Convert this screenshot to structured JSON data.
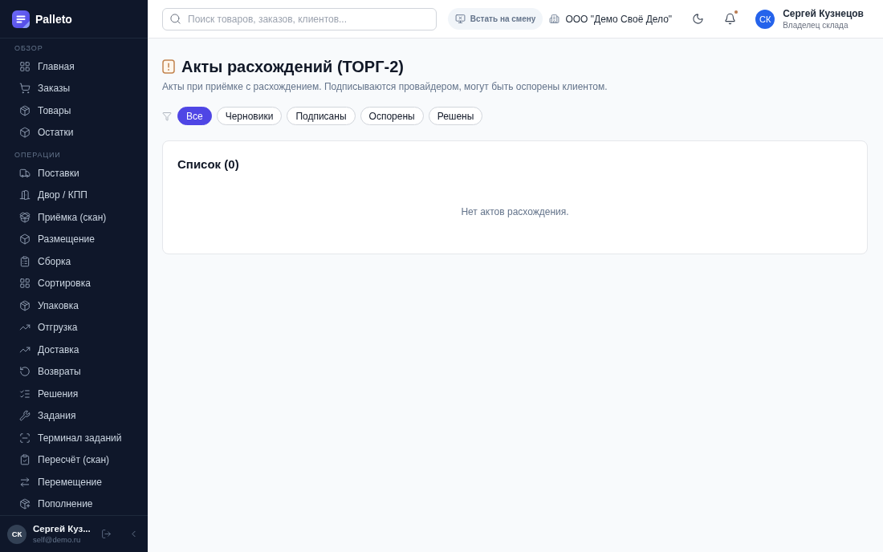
{
  "sidebar": {
    "logo": {
      "name": "Palleto"
    },
    "sections": [
      {
        "title": "ОБЗОР",
        "items": [
          {
            "label": "Главная",
            "selected": false
          },
          {
            "label": "Заказы",
            "selected": false
          },
          {
            "label": "Товары",
            "selected": false
          },
          {
            "label": "Остатки",
            "selected": false
          }
        ]
      },
      {
        "title": "ОПЕРАЦИИ",
        "items": [
          {
            "label": "Поставки",
            "selected": false
          },
          {
            "label": "Двор / КПП",
            "selected": false
          },
          {
            "label": "Приёмка (скан)",
            "selected": false
          },
          {
            "label": "Размещение",
            "selected": false
          },
          {
            "label": "Сборка",
            "selected": false
          },
          {
            "label": "Сортировка",
            "selected": false
          },
          {
            "label": "Упаковка",
            "selected": false
          },
          {
            "label": "Отгрузка",
            "selected": false
          },
          {
            "label": "Доставка",
            "selected": false
          },
          {
            "label": "Возвраты",
            "selected": false
          },
          {
            "label": "Решения",
            "selected": false
          },
          {
            "label": "Задания",
            "selected": false
          },
          {
            "label": "Терминал заданий",
            "selected": false
          },
          {
            "label": "Пересчёт (скан)",
            "selected": false
          },
          {
            "label": "Перемещение",
            "selected": false
          },
          {
            "label": "Пополнение",
            "selected": false
          }
        ]
      }
    ],
    "user": {
      "initials": "СК",
      "name": "Сергей Куз...",
      "email": "self@demo.ru"
    }
  },
  "topbar": {
    "search": {
      "placeholder": "Поиск товаров, заказов, клиентов..."
    },
    "shift_button": "Встать на смену",
    "company": "ООО \"Демо Своё Дело\"",
    "notifications": {
      "unread": true
    },
    "user": {
      "initials": "СК",
      "name": "Сергей Кузнецов",
      "role": "Владелец склада"
    }
  },
  "page": {
    "title": "Акты расхождений (ТОРГ-2)",
    "subtitle": "Акты при приёмке с расхождением. Подписываются провайдером, могут быть оспорены клиентом.",
    "filters": [
      {
        "label": "Все",
        "selected": true
      },
      {
        "label": "Черновики",
        "selected": false
      },
      {
        "label": "Подписаны",
        "selected": false
      },
      {
        "label": "Оспорены",
        "selected": false
      },
      {
        "label": "Решены",
        "selected": false
      }
    ],
    "card": {
      "title": "Список (0)",
      "empty_text": "Нет актов расхождения."
    }
  }
}
